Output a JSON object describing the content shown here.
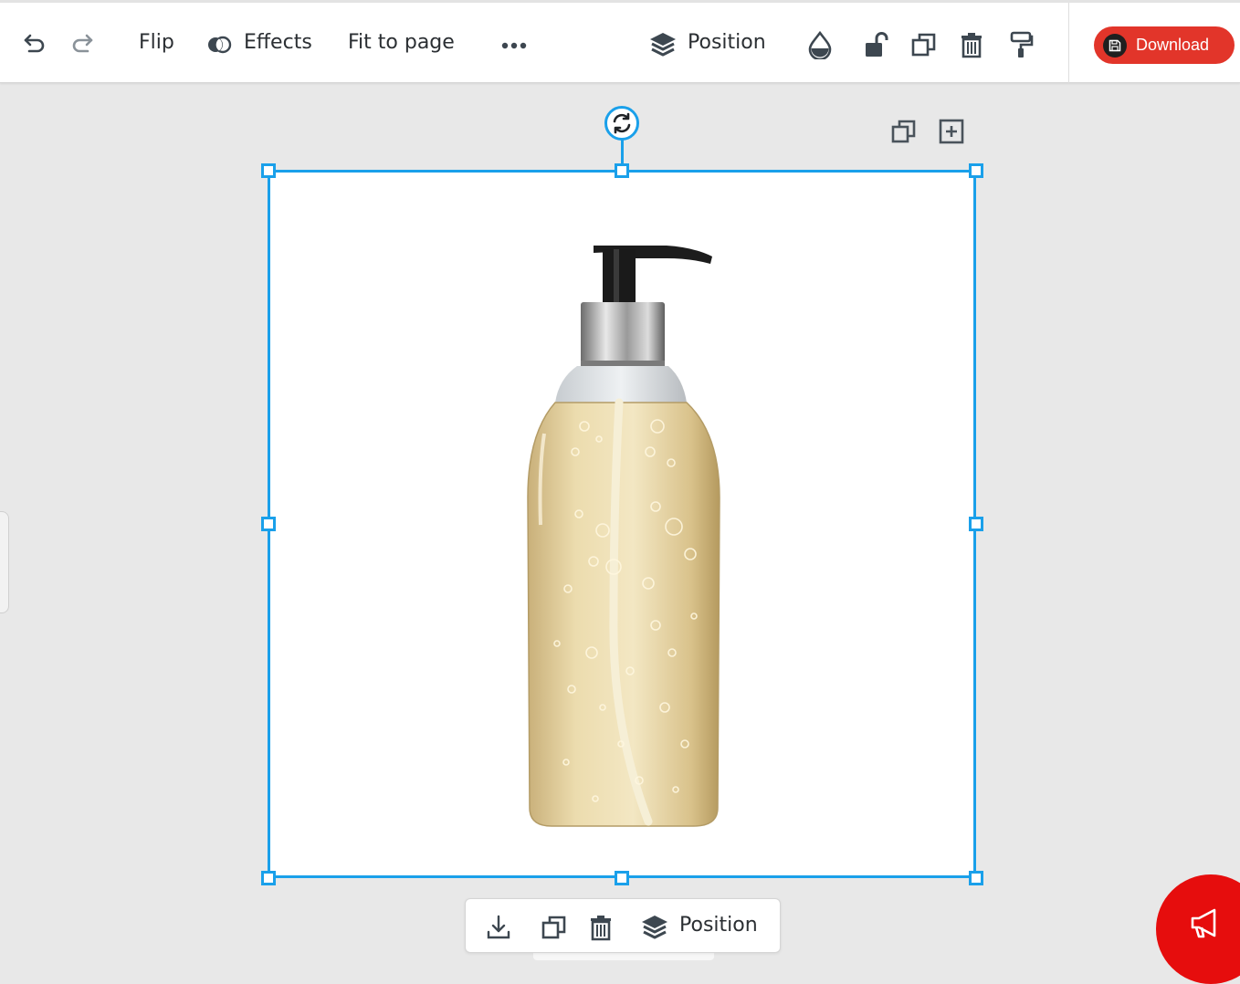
{
  "toolbar": {
    "flip_label": "Flip",
    "effects_label": "Effects",
    "fit_label": "Fit to page",
    "position_label": "Position",
    "download_label": "Download"
  },
  "context_bar": {
    "position_label": "Position"
  },
  "colors": {
    "selection": "#1aa0ea",
    "download": "#e2352a",
    "fab": "#e60d0d",
    "canvas_bg": "#e8e8e8"
  },
  "icons": {
    "toolbar": [
      "undo-icon",
      "redo-icon",
      "effects-icon",
      "more-icon",
      "layers-icon",
      "transparency-icon",
      "unlock-icon",
      "duplicate-icon",
      "trash-icon",
      "paint-roller-icon",
      "save-icon"
    ],
    "canvas": [
      "rotate-icon",
      "duplicate-icon",
      "add-page-icon"
    ],
    "context_bar": [
      "download-icon",
      "duplicate-icon",
      "trash-icon",
      "layers-icon"
    ],
    "fab": "megaphone-icon"
  }
}
